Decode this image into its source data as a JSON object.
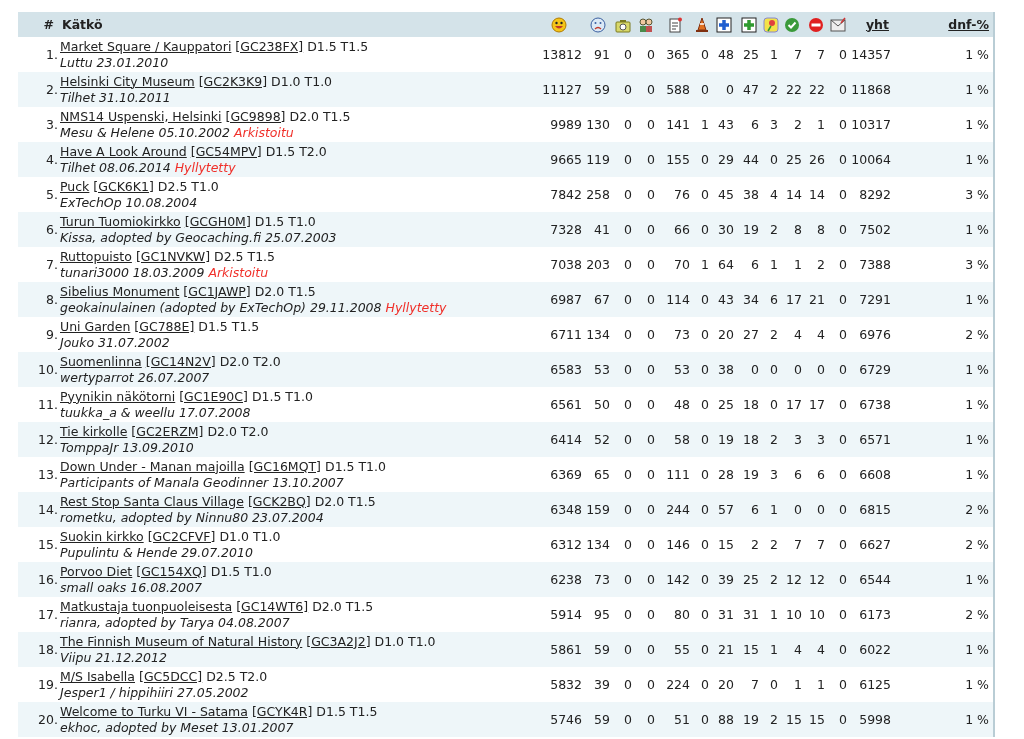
{
  "header": {
    "rank": "#",
    "name": "Kätkö",
    "total": "yht",
    "dnf": "dnf-%"
  },
  "rows": [
    {
      "rank": "1.",
      "name": "Market Square / Kauppatori",
      "code": "[GC238FX]",
      "rating": "D1.5 T1.5",
      "owner": "Luttu 23.01.2010",
      "counts": [
        "13812",
        "91",
        "0",
        "0",
        "365",
        "0",
        "48",
        "25",
        "1",
        "7",
        "7",
        "0"
      ],
      "total": "14357",
      "dnf": "1 %"
    },
    {
      "rank": "2.",
      "name": "Helsinki City Museum",
      "code": "[GC2K3K9]",
      "rating": "D1.0 T1.0",
      "owner": "Tilhet 31.10.2011",
      "counts": [
        "11127",
        "59",
        "0",
        "0",
        "588",
        "0",
        "0",
        "47",
        "2",
        "22",
        "22",
        "0"
      ],
      "total": "11868",
      "dnf": "1 %"
    },
    {
      "rank": "3.",
      "name": "NMS14 Uspenski, Helsinki",
      "code": "[GC9898]",
      "rating": "D2.0 T1.5",
      "owner": "Mesu & Helene 05.10.2002",
      "status": "Arkistoitu",
      "counts": [
        "9989",
        "130",
        "0",
        "0",
        "141",
        "1",
        "43",
        "6",
        "3",
        "2",
        "1",
        "0"
      ],
      "total": "10317",
      "dnf": "1 %"
    },
    {
      "rank": "4.",
      "name": "Have A Look Around",
      "code": "[GC54MPV]",
      "rating": "D1.5 T2.0",
      "owner": "Tilhet 08.06.2014",
      "status": "Hyllytetty",
      "counts": [
        "9665",
        "119",
        "0",
        "0",
        "155",
        "0",
        "29",
        "44",
        "0",
        "25",
        "26",
        "0"
      ],
      "total": "10064",
      "dnf": "1 %"
    },
    {
      "rank": "5.",
      "name": "Puck",
      "code": "[GCK6K1]",
      "rating": "D2.5 T1.0",
      "owner": "ExTechOp 10.08.2004",
      "counts": [
        "7842",
        "258",
        "0",
        "0",
        "76",
        "0",
        "45",
        "38",
        "4",
        "14",
        "14",
        "0"
      ],
      "total": "8292",
      "dnf": "3 %"
    },
    {
      "rank": "6.",
      "name": "Turun Tuomiokirkko",
      "code": "[GCGH0M]",
      "rating": "D1.5 T1.0",
      "owner": "Kissa, adopted by Geocaching.fi 25.07.2003",
      "counts": [
        "7328",
        "41",
        "0",
        "0",
        "66",
        "0",
        "30",
        "19",
        "2",
        "8",
        "8",
        "0"
      ],
      "total": "7502",
      "dnf": "1 %"
    },
    {
      "rank": "7.",
      "name": "Ruttopuisto",
      "code": "[GC1NVKW]",
      "rating": "D2.5 T1.5",
      "owner": "tunari3000 18.03.2009",
      "status": "Arkistoitu",
      "counts": [
        "7038",
        "203",
        "0",
        "0",
        "70",
        "1",
        "64",
        "6",
        "1",
        "1",
        "2",
        "0"
      ],
      "total": "7388",
      "dnf": "3 %"
    },
    {
      "rank": "8.",
      "name": "Sibelius Monument",
      "code": "[GC1JAWP]",
      "rating": "D2.0 T1.5",
      "owner": "geokainulainen (adopted by ExTechOp) 29.11.2008",
      "status": "Hyllytetty",
      "counts": [
        "6987",
        "67",
        "0",
        "0",
        "114",
        "0",
        "43",
        "34",
        "6",
        "17",
        "21",
        "0"
      ],
      "total": "7291",
      "dnf": "1 %"
    },
    {
      "rank": "9.",
      "name": "Uni Garden",
      "code": "[GC788E]",
      "rating": "D1.5 T1.5",
      "owner": "Jouko 31.07.2002",
      "counts": [
        "6711",
        "134",
        "0",
        "0",
        "73",
        "0",
        "20",
        "27",
        "2",
        "4",
        "4",
        "0"
      ],
      "total": "6976",
      "dnf": "2 %"
    },
    {
      "rank": "10.",
      "name": "Suomenlinna",
      "code": "[GC14N2V]",
      "rating": "D2.0 T2.0",
      "owner": "wertyparrot 26.07.2007",
      "counts": [
        "6583",
        "53",
        "0",
        "0",
        "53",
        "0",
        "38",
        "0",
        "0",
        "0",
        "0",
        "0"
      ],
      "total": "6729",
      "dnf": "1 %"
    },
    {
      "rank": "11.",
      "name": "Pyynikin näkötorni",
      "code": "[GC1E90C]",
      "rating": "D1.5 T1.0",
      "owner": "tuukka_a & weellu 17.07.2008",
      "counts": [
        "6561",
        "50",
        "0",
        "0",
        "48",
        "0",
        "25",
        "18",
        "0",
        "17",
        "17",
        "0"
      ],
      "total": "6738",
      "dnf": "1 %"
    },
    {
      "rank": "12.",
      "name": "Tie kirkolle",
      "code": "[GC2ERZM]",
      "rating": "D2.0 T2.0",
      "owner": "TomppaJr 13.09.2010",
      "counts": [
        "6414",
        "52",
        "0",
        "0",
        "58",
        "0",
        "19",
        "18",
        "2",
        "3",
        "3",
        "0"
      ],
      "total": "6571",
      "dnf": "1 %"
    },
    {
      "rank": "13.",
      "name": "Down Under - Manan majoilla",
      "code": "[GC16MQT]",
      "rating": "D1.5 T1.0",
      "owner": "Participants of Manala Geodinner 13.10.2007",
      "counts": [
        "6369",
        "65",
        "0",
        "0",
        "111",
        "0",
        "28",
        "19",
        "3",
        "6",
        "6",
        "0"
      ],
      "total": "6608",
      "dnf": "1 %"
    },
    {
      "rank": "14.",
      "name": "Rest Stop Santa Claus Village",
      "code": "[GCK2BQ]",
      "rating": "D2.0 T1.5",
      "owner": "rometku, adopted by Ninnu80 23.07.2004",
      "counts": [
        "6348",
        "159",
        "0",
        "0",
        "244",
        "0",
        "57",
        "6",
        "1",
        "0",
        "0",
        "0"
      ],
      "total": "6815",
      "dnf": "2 %"
    },
    {
      "rank": "15.",
      "name": "Suokin kirkko",
      "code": "[GC2CFVF]",
      "rating": "D1.0 T1.0",
      "owner": "Pupulintu & Hende 29.07.2010",
      "counts": [
        "6312",
        "134",
        "0",
        "0",
        "146",
        "0",
        "15",
        "2",
        "2",
        "7",
        "7",
        "0"
      ],
      "total": "6627",
      "dnf": "2 %"
    },
    {
      "rank": "16.",
      "name": "Porvoo Diet",
      "code": "[GC154XQ]",
      "rating": "D1.5 T1.0",
      "owner": "small oaks 16.08.2007",
      "counts": [
        "6238",
        "73",
        "0",
        "0",
        "142",
        "0",
        "39",
        "25",
        "2",
        "12",
        "12",
        "0"
      ],
      "total": "6544",
      "dnf": "1 %"
    },
    {
      "rank": "17.",
      "name": "Matkustaja tuonpuoleisesta",
      "code": "[GC14WT6]",
      "rating": "D2.0 T1.5",
      "owner": "rianra, adopted by Tarya 04.08.2007",
      "counts": [
        "5914",
        "95",
        "0",
        "0",
        "80",
        "0",
        "31",
        "31",
        "1",
        "10",
        "10",
        "0"
      ],
      "total": "6173",
      "dnf": "2 %"
    },
    {
      "rank": "18.",
      "name": "The Finnish Museum of Natural History",
      "code": "[GC3A2J2]",
      "rating": "D1.0 T1.0",
      "owner": "Viipu 21.12.2012",
      "counts": [
        "5861",
        "59",
        "0",
        "0",
        "55",
        "0",
        "21",
        "15",
        "1",
        "4",
        "4",
        "0"
      ],
      "total": "6022",
      "dnf": "1 %"
    },
    {
      "rank": "19.",
      "name": "M/S Isabella",
      "code": "[GC5DCC]",
      "rating": "D2.5 T2.0",
      "owner": "Jesper1 / hippihiiri 27.05.2002",
      "counts": [
        "5832",
        "39",
        "0",
        "0",
        "224",
        "0",
        "20",
        "7",
        "0",
        "1",
        "1",
        "0"
      ],
      "total": "6125",
      "dnf": "1 %"
    },
    {
      "rank": "20.",
      "name": "Welcome to Turku VI - Satama",
      "code": "[GCYK4R]",
      "rating": "D1.5 T1.5",
      "owner": "ekhoc, adopted by Meset 13.01.2007",
      "counts": [
        "5746",
        "59",
        "0",
        "0",
        "51",
        "0",
        "88",
        "19",
        "2",
        "15",
        "15",
        "0"
      ],
      "total": "5998",
      "dnf": "1 %"
    }
  ]
}
